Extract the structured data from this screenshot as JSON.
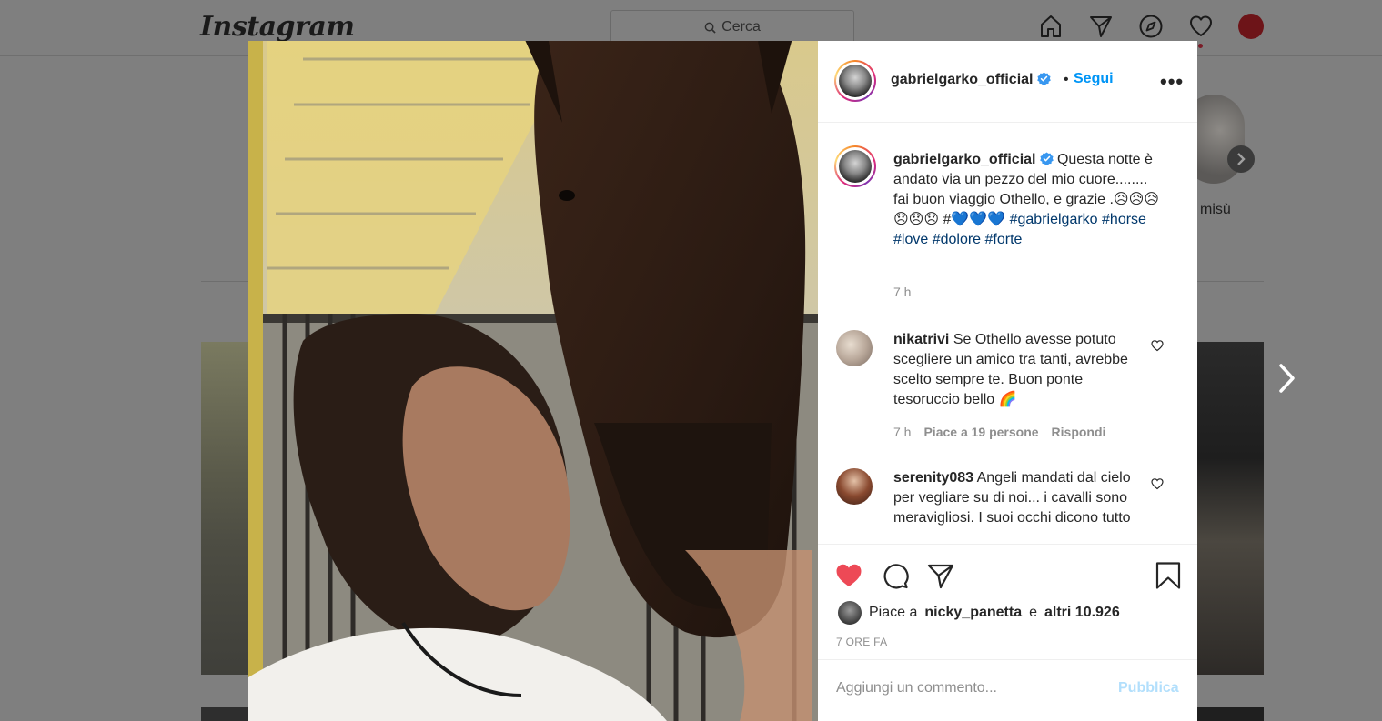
{
  "topnav": {
    "logo": "Instagram",
    "search_placeholder": "Cerca"
  },
  "background": {
    "story_label": "misù"
  },
  "post": {
    "username": "gabrielgarko_official",
    "separator": "•",
    "follow_label": "Segui",
    "more_label": "•••",
    "caption": {
      "username": "gabrielgarko_official",
      "text": "Questa notte è andato via un pezzo del mio cuore........ fai buon viaggio Othello, e grazie .😥😥😥😞😞😞 #💙💙💙",
      "hashtags": [
        "#gabrielgarko",
        "#horse",
        "#love",
        "#dolore",
        "#forte"
      ],
      "time": "7 h"
    },
    "comments": [
      {
        "username": "nikatrivi",
        "text": "Se Othello avesse potuto scegliere un amico tra tanti, avrebbe scelto sempre te. Buon ponte tesoruccio bello 🌈",
        "time": "7 h",
        "likes": "Piace a 19 persone",
        "reply": "Rispondi"
      },
      {
        "username": "serenity083",
        "text": "Angeli mandati dal cielo per vegliare su di noi... i cavalli sono meravigliosi. I suoi occhi dicono tutto",
        "time": "",
        "likes": "",
        "reply": ""
      }
    ],
    "likes": {
      "prefix": "Piace a",
      "user": "nicky_panetta",
      "middle": "e",
      "others": "altri 10.926"
    },
    "age": "7 ORE FA",
    "add_comment_placeholder": "Aggiungi un commento...",
    "publish_label": "Pubblica"
  },
  "colors": {
    "accent": "#0095f6",
    "like_red": "#ed4956",
    "hashtag": "#00376b",
    "overlay_bg": "#7f7f7f"
  }
}
